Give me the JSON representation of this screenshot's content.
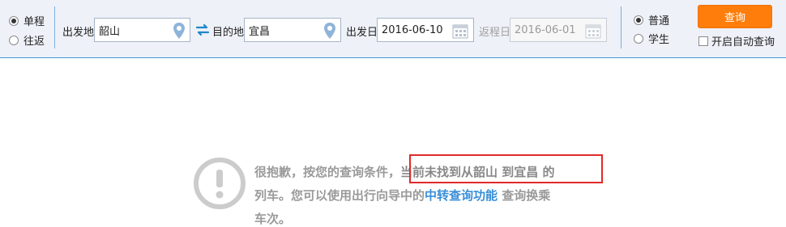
{
  "trip_type": {
    "one_way_label": "单程",
    "round_trip_label": "往返",
    "selected": "单程"
  },
  "from": {
    "label": "出发地",
    "value": "韶山"
  },
  "to": {
    "label": "目的地",
    "value": "宜昌"
  },
  "depart_date": {
    "label": "出发日",
    "value": "2016-06-10"
  },
  "return_date": {
    "label": "返程日",
    "value": "2016-06-01"
  },
  "passenger_type": {
    "normal_label": "普通",
    "student_label": "学生",
    "selected": "普通"
  },
  "actions": {
    "query_label": "查询",
    "auto_query_label": "开启自动查询"
  },
  "message": {
    "part1": "很抱歉，按您的查询条件，",
    "highlight": "当前未找到从韶山 到宜昌 的",
    "part2": "列车。您可以使用出行向导中的",
    "link": "中转查询功能",
    "part3": " 查询换乘",
    "part4": "车次。"
  },
  "colors": {
    "toolbar_bg": "#eef1f8",
    "accent_blue": "#3a8fd8",
    "button_orange": "#ff7d0a",
    "highlight_border": "#e02a2a",
    "message_gray": "#9a9a9a"
  },
  "icons": {
    "location": "location-pin-icon",
    "calendar": "calendar-icon",
    "swap": "swap-arrows-icon",
    "warning": "exclamation-circle-icon"
  }
}
